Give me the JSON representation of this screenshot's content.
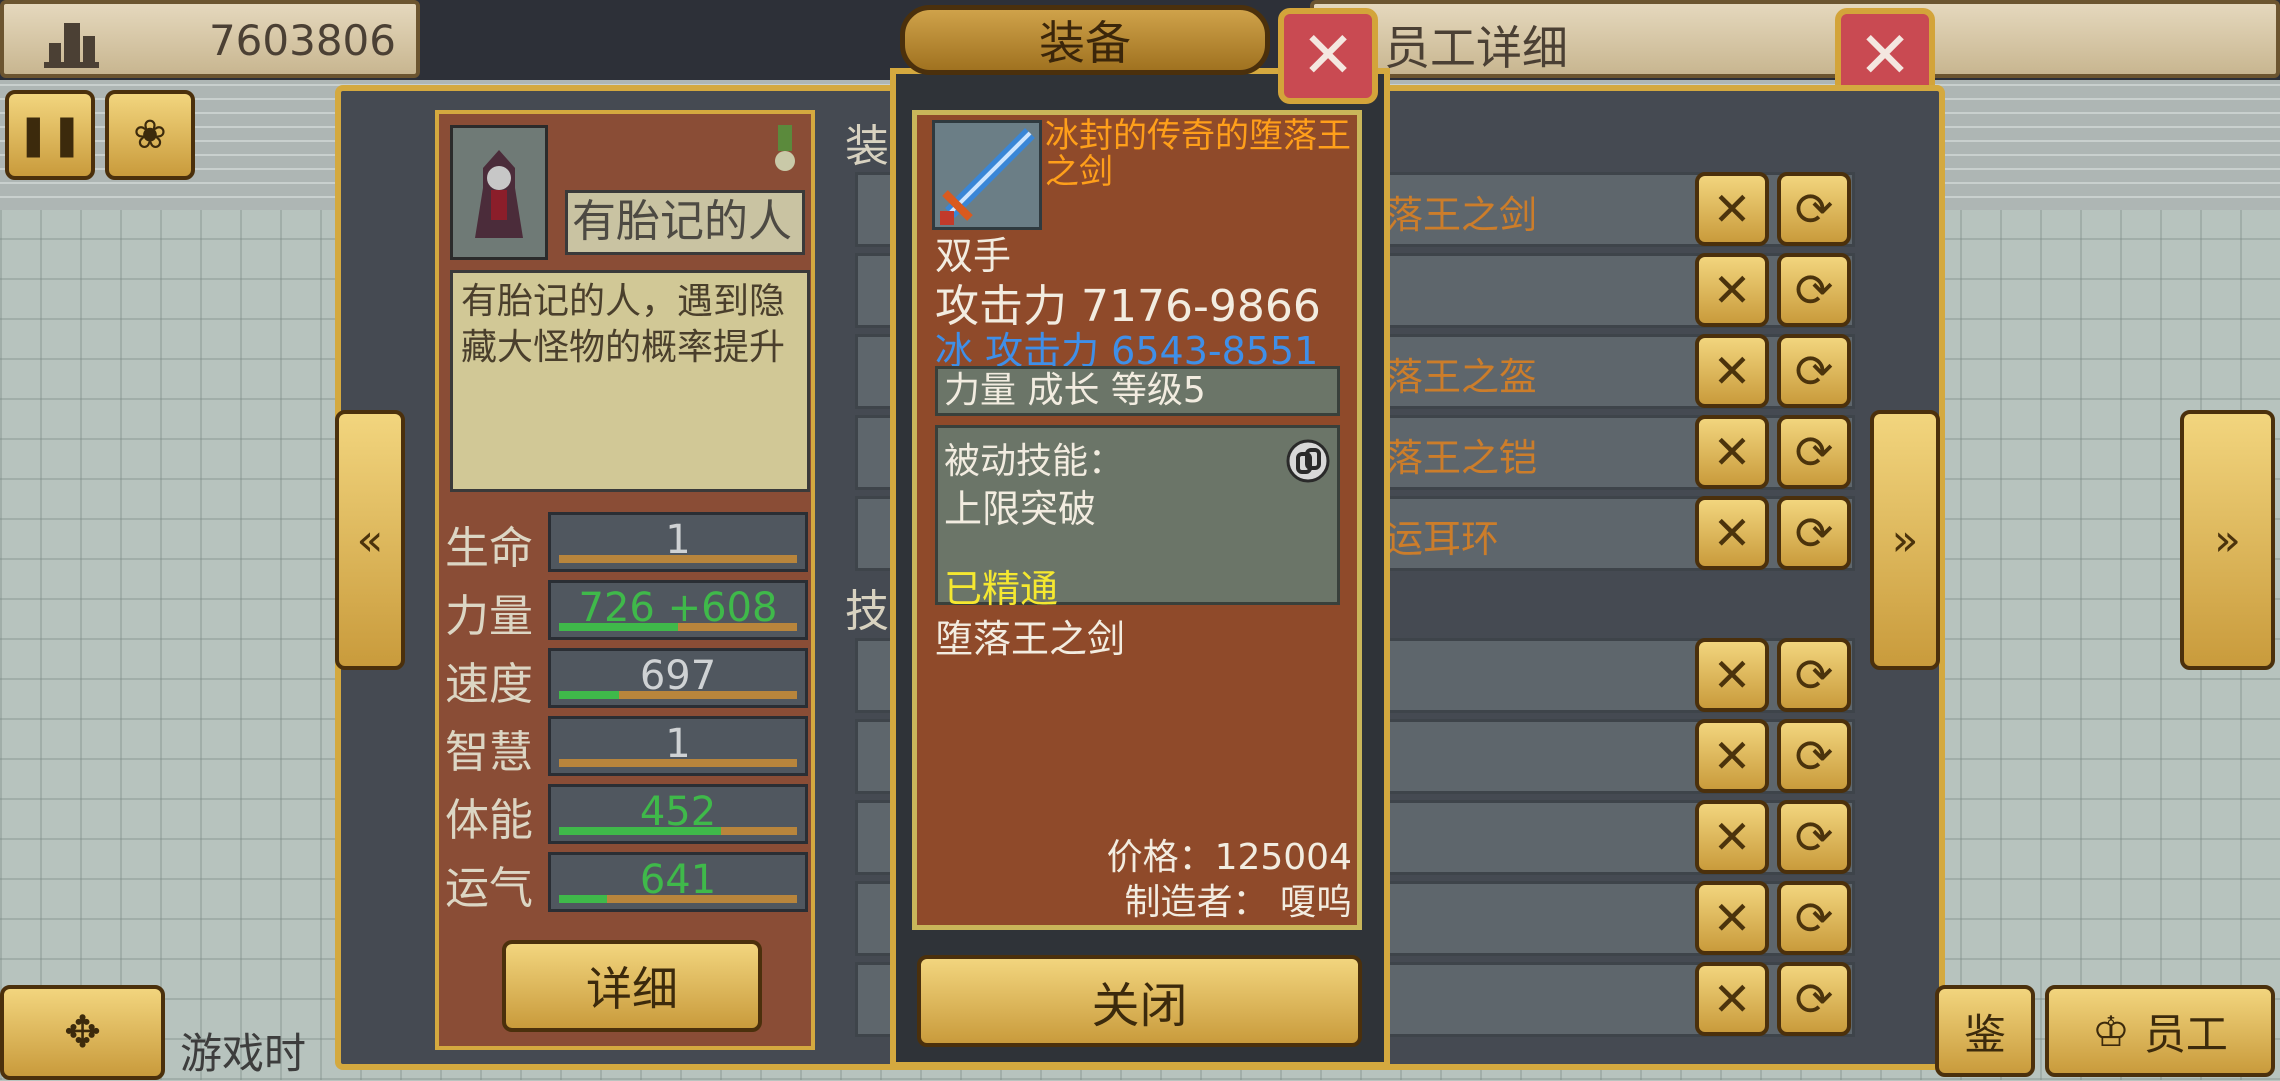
{
  "top": {
    "money": "7603806",
    "right_bar_title": "员工详细",
    "close_glyph": "✕"
  },
  "toolbar": {
    "pause_icon": "pause-icon",
    "map_icon": "map-icon"
  },
  "employee": {
    "name": "有胎记的人",
    "description": "有胎记的人，遇到隐藏大怪物的概率提升",
    "stats": [
      {
        "label": "生命",
        "value": "1",
        "fill": 0.0,
        "color": "#cfd2d4"
      },
      {
        "label": "力量",
        "value": "726 +608",
        "fill": 0.5,
        "color": "#3fb94a"
      },
      {
        "label": "速度",
        "value": "697",
        "fill": 0.25,
        "color": "#cfd2d4"
      },
      {
        "label": "智慧",
        "value": "1",
        "fill": 0.0,
        "color": "#cfd2d4"
      },
      {
        "label": "体能",
        "value": "452",
        "fill": 0.68,
        "color": "#3fb94a"
      },
      {
        "label": "运气",
        "value": "641",
        "fill": 0.2,
        "color": "#3fb94a"
      }
    ],
    "detail_label": "详细"
  },
  "list": {
    "equip_section": "装",
    "skill_section": "技",
    "equip_rows": [
      "落王之剑",
      "",
      "落王之盔",
      "落王之铠",
      "运耳环"
    ],
    "skill_rows": [
      "",
      "",
      "",
      "",
      ""
    ]
  },
  "popup": {
    "title": "装备",
    "item_name": "冰封的传奇的堕落王之剑",
    "hand": "双手",
    "attack": "攻击力 7176-9866",
    "ice_attack": "冰 攻击力 6543-8551",
    "growth": "力量 成长 等级5",
    "passive_label": "被动技能：",
    "passive_skill": "上限突破",
    "mastered": "已精通",
    "base_name": "堕落王之剑",
    "price": "价格：125004",
    "maker": "制造者： 嗄呜",
    "close_label": "关闭"
  },
  "bottom": {
    "game_time": "游戏时",
    "encyclopedia": "鉴",
    "staff": "员工"
  }
}
